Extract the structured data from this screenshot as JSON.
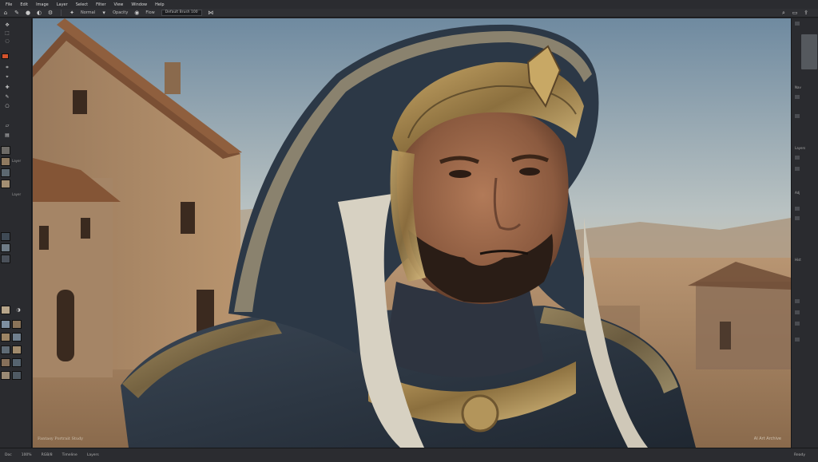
{
  "menu": {
    "items": [
      "File",
      "Edit",
      "Image",
      "Layer",
      "Select",
      "Filter",
      "View",
      "Window",
      "Help"
    ]
  },
  "options": {
    "mode_label": "Normal",
    "opacity_label": "Opacity",
    "flow_label": "Flow",
    "preset_value": "Default Brush 100"
  },
  "toolbar": {
    "fg_color": "#d4532c",
    "layer_labels": [
      "Layer",
      "Layer"
    ]
  },
  "canvas": {
    "watermark_left": "Fantasy Portrait Study",
    "watermark_right": "AI Art Archive"
  },
  "right_panel": {
    "labels": [
      "Nav",
      "Layers",
      "Adj",
      "Hist"
    ]
  },
  "status": {
    "left_items": [
      "Doc",
      "100%",
      "RGB/8",
      "Timeline",
      "Layers"
    ],
    "right_text": "Ready"
  }
}
